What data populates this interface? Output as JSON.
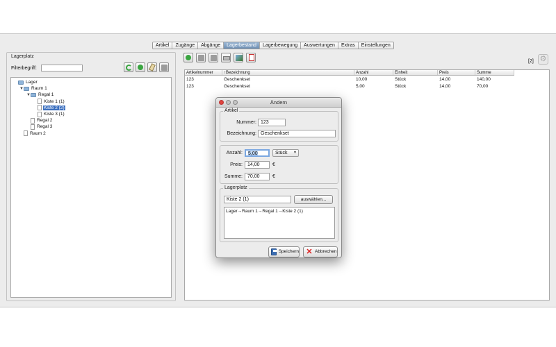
{
  "tabs": [
    {
      "label": "Artikel",
      "active": false
    },
    {
      "label": "Zugänge",
      "active": false
    },
    {
      "label": "Abgänge",
      "active": false
    },
    {
      "label": "Lagerbestand",
      "active": true
    },
    {
      "label": "Lagerbewegung",
      "active": false
    },
    {
      "label": "Auswertungen",
      "active": false
    },
    {
      "label": "Extras",
      "active": false
    },
    {
      "label": "Einstellungen",
      "active": false
    }
  ],
  "left_panel": {
    "title": "Lagerplatz",
    "filter_label": "Filterbegriff:",
    "filter_value": "",
    "toolbar_icons": [
      "refresh-icon",
      "add-icon",
      "edit-icon",
      "delete-icon"
    ],
    "tree": [
      {
        "label": "Lager",
        "kind": "folder",
        "expanded": null,
        "selected": false
      },
      {
        "label": "Raum 1",
        "kind": "folder",
        "expanded": true,
        "selected": false
      },
      {
        "label": "Regal 1",
        "kind": "folder",
        "expanded": true,
        "selected": false
      },
      {
        "label": "Kiste 1 (1)",
        "kind": "doc",
        "expanded": null,
        "selected": false
      },
      {
        "label": "Kiste 2 (2)",
        "kind": "doc",
        "expanded": null,
        "selected": true
      },
      {
        "label": "Kiste 3 (1)",
        "kind": "doc",
        "expanded": null,
        "selected": false
      },
      {
        "label": "Regal 2",
        "kind": "doc",
        "expanded": null,
        "selected": false
      },
      {
        "label": "Regal 3",
        "kind": "doc",
        "expanded": null,
        "selected": false
      },
      {
        "label": "Raum 2",
        "kind": "doc",
        "expanded": null,
        "selected": false
      }
    ]
  },
  "right_panel": {
    "toolbar_icons": [
      "add-icon",
      "delete-icon",
      "copy-icon",
      "print-icon",
      "export-icon",
      "pdf-icon"
    ],
    "count": "[2]",
    "settings_icon": "gear-icon",
    "columns": [
      "Artikelnummer",
      "↑Bezeichnung",
      "Anzahl",
      "Einheit",
      "Preis",
      "Summe"
    ],
    "rows": [
      [
        "123",
        "Geschenkset",
        "10,00",
        "Stück",
        "14,00",
        "140,00"
      ],
      [
        "123",
        "Geschenkset",
        "5,00",
        "Stück",
        "14,00",
        "70,00"
      ]
    ]
  },
  "dialog": {
    "title": "Ändern",
    "artikel_group": "Artikel",
    "nummer_label": "Nummer:",
    "nummer_value": "123",
    "bezeichnung_label": "Bezeichnung:",
    "bezeichnung_value": "Geschenkset",
    "anzahl_label": "Anzahl:",
    "anzahl_value": "5,00",
    "einheit_value": "Stück",
    "preis_label": "Preis:",
    "preis_value": "14,00",
    "preis_unit": "€",
    "summe_label": "Summe:",
    "summe_value": "70,00",
    "summe_unit": "€",
    "lagerplatz_group": "Lagerplatz",
    "lagerplatz_value": "Kiste 2 (1)",
    "choose_button": "auswählen...",
    "path": "Lager→Raum 1→Regal 1→Kiste 2 (1)",
    "save_button": "Speichern",
    "cancel_button": "Abbrechen"
  }
}
